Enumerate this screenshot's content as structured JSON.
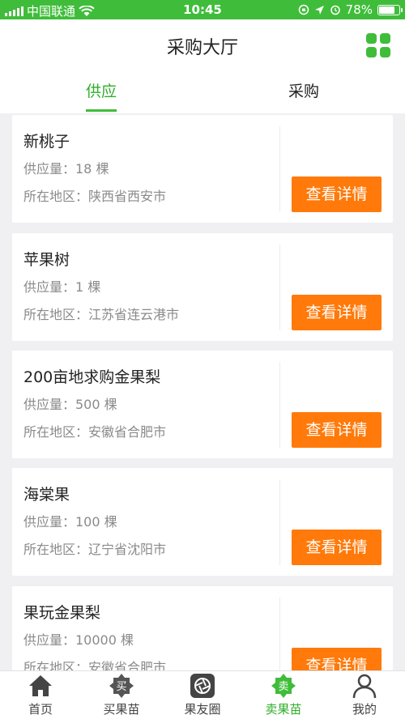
{
  "status_bar": {
    "carrier": "中国联通",
    "time": "10:45",
    "battery": "78%",
    "battery_level": 0.78
  },
  "header": {
    "title": "采购大厅"
  },
  "tabs": [
    {
      "label": "供应",
      "active": true
    },
    {
      "label": "采购",
      "active": false
    }
  ],
  "cards": [
    {
      "name": "新桃子",
      "supply": "供应量：18 棵",
      "region": "所在地区：陕西省西安市",
      "button": "查看详情"
    },
    {
      "name": "苹果树",
      "supply": "供应量：1 棵",
      "region": "所在地区：江苏省连云港市",
      "button": "查看详情"
    },
    {
      "name": "200亩地求购金果梨",
      "supply": "供应量：500 棵",
      "region": "所在地区：安徽省合肥市",
      "button": "查看详情"
    },
    {
      "name": "海棠果",
      "supply": "供应量：100 棵",
      "region": "所在地区：辽宁省沈阳市",
      "button": "查看详情"
    },
    {
      "name": "果玩金果梨",
      "supply": "供应量：10000 棵",
      "region": "所在地区：安徽省合肥市",
      "button": "查看详情"
    }
  ],
  "tabbar": [
    {
      "label": "首页",
      "icon": "home-icon",
      "active": false
    },
    {
      "label": "买果苗",
      "icon": "buy-seedling-icon",
      "badge": "买",
      "active": false
    },
    {
      "label": "果友圈",
      "icon": "camera-shutter-icon",
      "active": false
    },
    {
      "label": "卖果苗",
      "icon": "sell-seedling-icon",
      "badge": "卖",
      "active": true
    },
    {
      "label": "我的",
      "icon": "user-icon",
      "active": false
    }
  ],
  "colors": {
    "primary_green": "#3fbd3a",
    "accent_orange": "#ff7a0a"
  }
}
